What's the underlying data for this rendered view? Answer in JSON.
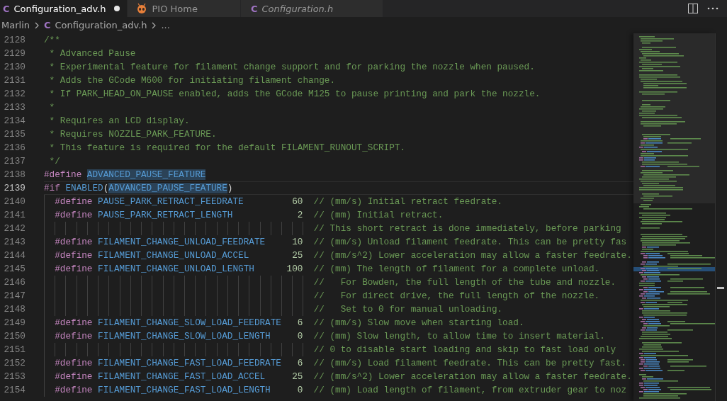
{
  "tabs": [
    {
      "kind": "c-file",
      "icon_text": "C",
      "label": "Configuration_adv.h",
      "selected": true,
      "modified": true,
      "preview": false
    },
    {
      "kind": "pio",
      "label": "PIO Home",
      "selected": false,
      "modified": false,
      "preview": false
    },
    {
      "kind": "c-file",
      "icon_text": "C",
      "label": "Configuration.h",
      "selected": false,
      "modified": false,
      "preview": true
    }
  ],
  "breadcrumb": {
    "folder": "Marlin",
    "file_icon_text": "C",
    "file": "Configuration_adv.h",
    "more": "..."
  },
  "editor": {
    "lines": [
      {
        "kind": "doc",
        "number": "2128",
        "current": false,
        "text": "/**"
      },
      {
        "kind": "doc",
        "number": "2129",
        "current": false,
        "text": " * Advanced Pause"
      },
      {
        "kind": "doc",
        "number": "2130",
        "current": false,
        "text": " * Experimental feature for filament change support and for parking the nozzle when paused."
      },
      {
        "kind": "doc",
        "number": "2131",
        "current": false,
        "text": " * Adds the GCode M600 for initiating filament change."
      },
      {
        "kind": "doc",
        "number": "2132",
        "current": false,
        "text": " * If PARK_HEAD_ON_PAUSE enabled, adds the GCode M125 to pause printing and park the nozzle."
      },
      {
        "kind": "doc",
        "number": "2133",
        "current": false,
        "text": " *"
      },
      {
        "kind": "doc",
        "number": "2134",
        "current": false,
        "text": " * Requires an LCD display."
      },
      {
        "kind": "doc",
        "number": "2135",
        "current": false,
        "text": " * Requires NOZZLE_PARK_FEATURE."
      },
      {
        "kind": "doc",
        "number": "2136",
        "current": false,
        "text": " * This feature is required for the default FILAMENT_RUNOUT_SCRIPT."
      },
      {
        "kind": "doc",
        "number": "2137",
        "current": false,
        "text": " */"
      },
      {
        "kind": "define",
        "number": "2138",
        "current": false,
        "directive": "#define",
        "name": "ADVANCED_PAUSE_FEATURE",
        "highlighted": true
      },
      {
        "kind": "if",
        "number": "2139",
        "current": true,
        "directive": "#if",
        "tokens": [
          {
            "kind": "macro",
            "text": "ENABLED",
            "highlighted": false
          },
          {
            "kind": "plain",
            "text": "("
          },
          {
            "kind": "macro",
            "text": "ADVANCED_PAUSE_FEATURE",
            "highlighted": true
          },
          {
            "kind": "plain",
            "text": ")"
          }
        ],
        "children": [
          {
            "kind": "define",
            "number": "2140",
            "current": false,
            "directive": "#define",
            "name": "PAUSE_PARK_RETRACT_FEEDRATE",
            "highlighted": false,
            "value": "60",
            "comment": "// (mm/s) Initial retract feedrate."
          },
          {
            "kind": "define",
            "number": "2141",
            "current": false,
            "directive": "#define",
            "name": "PAUSE_PARK_RETRACT_LENGTH",
            "highlighted": false,
            "value": "2",
            "comment": "// (mm) Initial retract."
          },
          {
            "kind": "note",
            "number": "2142",
            "current": false,
            "comment": "// This short retract is done immediately, before parking"
          },
          {
            "kind": "define",
            "number": "2143",
            "current": false,
            "directive": "#define",
            "name": "FILAMENT_CHANGE_UNLOAD_FEEDRATE",
            "highlighted": false,
            "value": "10",
            "comment": "// (mm/s) Unload filament feedrate. This can be pretty fas"
          },
          {
            "kind": "define",
            "number": "2144",
            "current": false,
            "directive": "#define",
            "name": "FILAMENT_CHANGE_UNLOAD_ACCEL",
            "highlighted": false,
            "value": "25",
            "comment": "// (mm/s^2) Lower acceleration may allow a faster feedrate."
          },
          {
            "kind": "define",
            "number": "2145",
            "current": false,
            "directive": "#define",
            "name": "FILAMENT_CHANGE_UNLOAD_LENGTH",
            "highlighted": false,
            "value": "100",
            "comment": "// (mm) The length of filament for a complete unload."
          },
          {
            "kind": "note",
            "number": "2146",
            "current": false,
            "comment": "//   For Bowden, the full length of the tube and nozzle."
          },
          {
            "kind": "note",
            "number": "2147",
            "current": false,
            "comment": "//   For direct drive, the full length of the nozzle."
          },
          {
            "kind": "note",
            "number": "2148",
            "current": false,
            "comment": "//   Set to 0 for manual unloading."
          },
          {
            "kind": "define",
            "number": "2149",
            "current": false,
            "directive": "#define",
            "name": "FILAMENT_CHANGE_SLOW_LOAD_FEEDRATE",
            "highlighted": false,
            "value": "6",
            "comment": "// (mm/s) Slow move when starting load."
          },
          {
            "kind": "define",
            "number": "2150",
            "current": false,
            "directive": "#define",
            "name": "FILAMENT_CHANGE_SLOW_LOAD_LENGTH",
            "highlighted": false,
            "value": "0",
            "comment": "// (mm) Slow length, to allow time to insert material."
          },
          {
            "kind": "note",
            "number": "2151",
            "current": false,
            "comment": "// 0 to disable start loading and skip to fast load only"
          },
          {
            "kind": "define",
            "number": "2152",
            "current": false,
            "directive": "#define",
            "name": "FILAMENT_CHANGE_FAST_LOAD_FEEDRATE",
            "highlighted": false,
            "value": "6",
            "comment": "// (mm/s) Load filament feedrate. This can be pretty fast."
          },
          {
            "kind": "define",
            "number": "2153",
            "current": false,
            "directive": "#define",
            "name": "FILAMENT_CHANGE_FAST_LOAD_ACCEL",
            "highlighted": false,
            "value": "25",
            "comment": "// (mm/s^2) Lower acceleration may allow a faster feedrate."
          },
          {
            "kind": "define",
            "number": "2154",
            "current": false,
            "directive": "#define",
            "name": "FILAMENT_CHANGE_FAST_LOAD_LENGTH",
            "highlighted": false,
            "value": "0",
            "comment": "// (mm) Load length of filament, from extruder gear to noz"
          }
        ]
      }
    ]
  }
}
